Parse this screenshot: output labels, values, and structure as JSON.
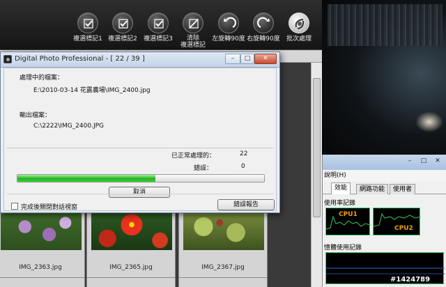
{
  "toolbar": {
    "buttons": [
      {
        "label": "複選標記1"
      },
      {
        "label": "複選標記2"
      },
      {
        "label": "複選標記3"
      },
      {
        "label": "清除",
        "label2": "複選標記"
      },
      {
        "label": "左旋轉90度"
      },
      {
        "label": "右旋轉90度"
      },
      {
        "label": "批次處理"
      }
    ]
  },
  "thumbnails": [
    {
      "name": "IMG_2363.jpg"
    },
    {
      "name": "IMG_2365.jpg"
    },
    {
      "name": "IMG_2367.jpg"
    }
  ],
  "dialog": {
    "title": "Digital Photo Professional - [ 22 / 39 ]",
    "processing_label": "處理中的檔案：",
    "processing_file": "E:\\2010-03-14 花露農場\\IMG_2400.jpg",
    "output_label": "輸出檔案：",
    "output_file": "C:\\2222\\IMG_2400.JPG",
    "processed_label": "已正常處理的：",
    "processed_count": "22",
    "errors_label": "錯誤：",
    "errors_count": "0",
    "progress": 0.56,
    "cancel_label": "取消",
    "close_checkbox_label": "完成後關閉對話視窗",
    "close_checkbox_checked": false,
    "error_report_label": "錯誤報告"
  },
  "task_manager": {
    "menu_help": "說明(H)",
    "tabs": [
      "效能",
      "網路功能",
      "使用者"
    ],
    "active_tab": "效能",
    "cpu_history_label": "使用率記錄",
    "cpu_labels": [
      "CPU1",
      "CPU2"
    ],
    "mem_history_label": "憶體使用記錄"
  },
  "watermark": "#1424789",
  "colors": {
    "progress_fill": "#22b41e",
    "cpu_graph": "#33cc66",
    "cpu_label": "#f2a200"
  }
}
